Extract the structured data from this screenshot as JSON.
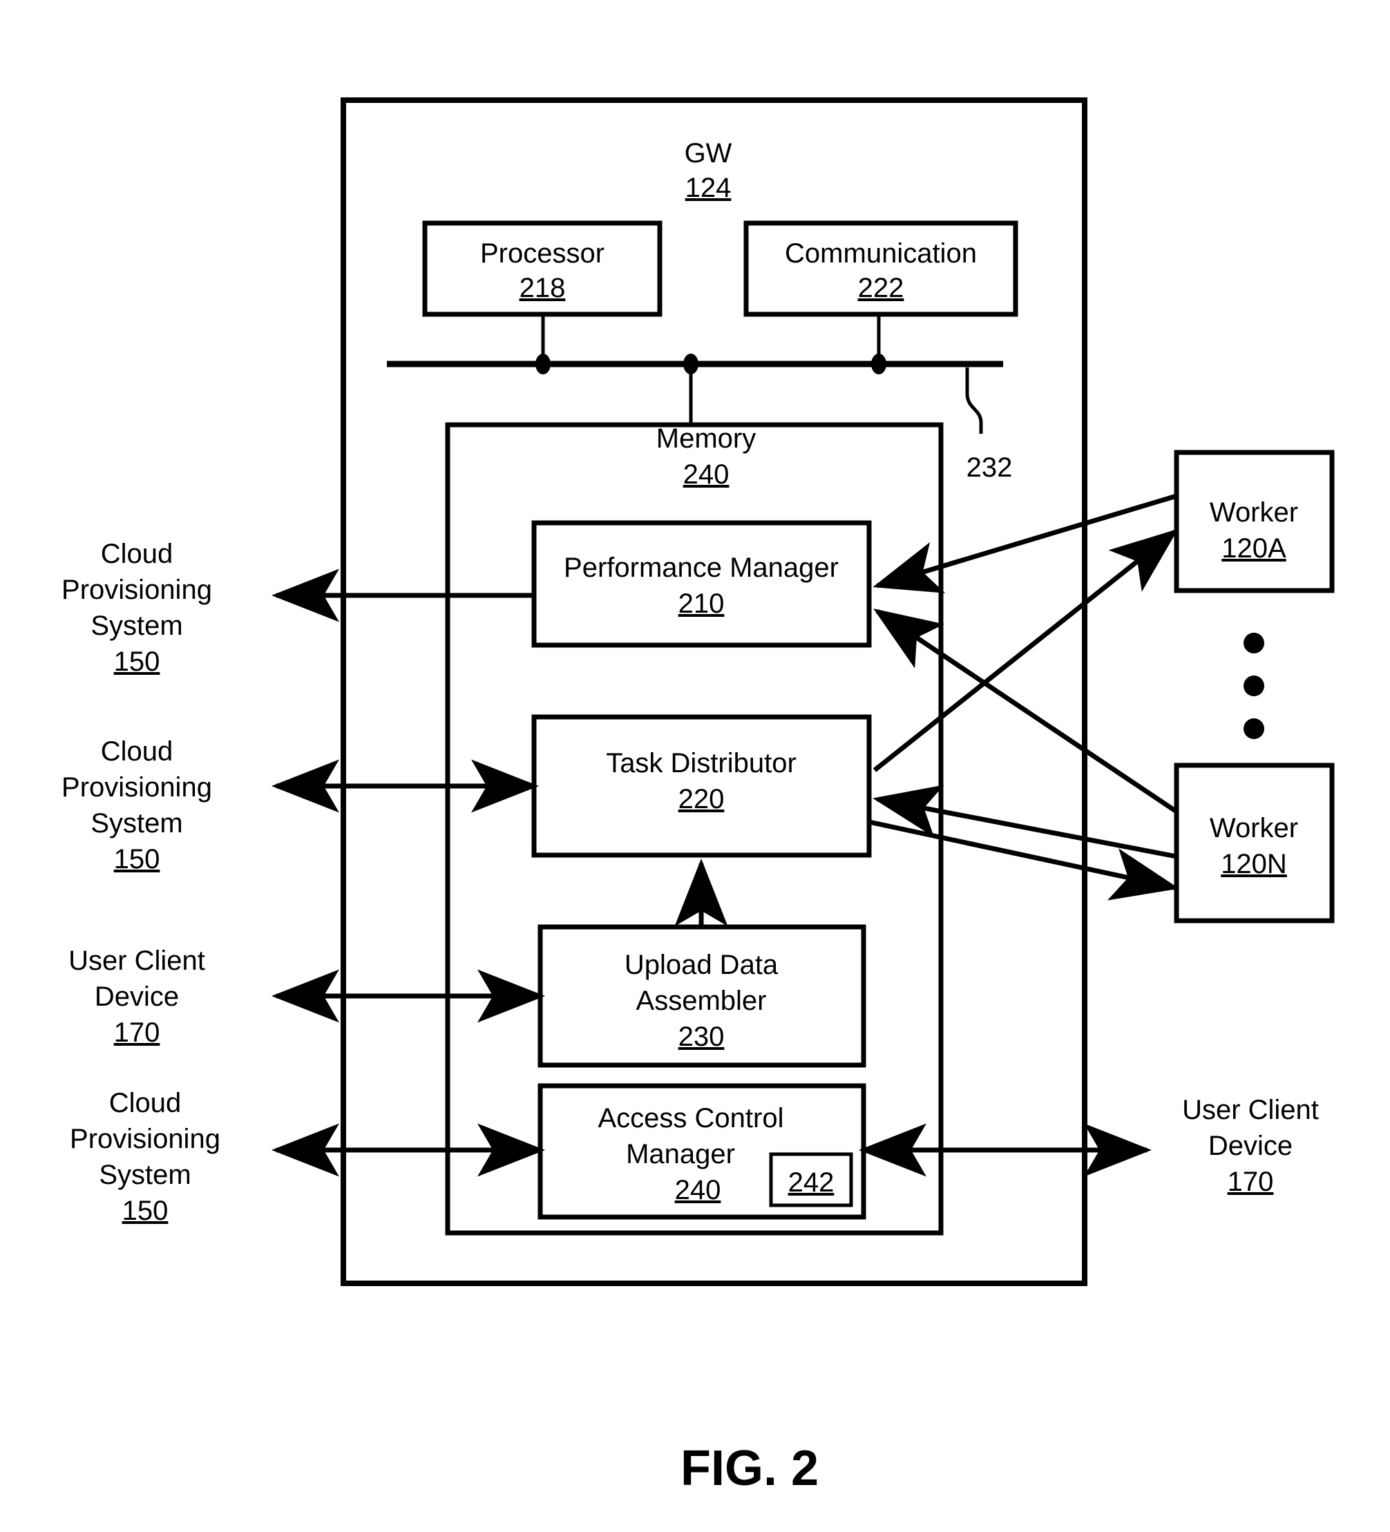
{
  "figure": {
    "caption": "FIG. 2"
  },
  "gw": {
    "title": "GW",
    "ref": "124"
  },
  "processor": {
    "title": "Processor",
    "ref": "218"
  },
  "communication": {
    "title": "Communication",
    "ref": "222"
  },
  "bus": {
    "ref": "232"
  },
  "memory": {
    "title": "Memory",
    "ref": "240"
  },
  "modules": [
    {
      "name": "performance-manager",
      "title": "Performance Manager",
      "ref": "210"
    },
    {
      "name": "task-distributor",
      "title": "Task Distributor",
      "ref": "220"
    },
    {
      "name": "upload-data-assembler",
      "title_line1": "Upload Data",
      "title_line2": "Assembler",
      "ref": "230"
    },
    {
      "name": "access-control-manager",
      "title_line1": "Access Control",
      "title_line2": "Manager",
      "ref": "240",
      "inner_ref": "242"
    }
  ],
  "external_left": [
    {
      "name": "cloud-provisioning-system-1",
      "line1": "Cloud",
      "line2": "Provisioning",
      "line3": "System",
      "ref": "150"
    },
    {
      "name": "cloud-provisioning-system-2",
      "line1": "Cloud",
      "line2": "Provisioning",
      "line3": "System",
      "ref": "150"
    },
    {
      "name": "user-client-device-left",
      "line1": "User Client",
      "line2": "Device",
      "ref": "170"
    },
    {
      "name": "cloud-provisioning-system-3",
      "line1": "Cloud",
      "line2": "Provisioning",
      "line3": "System",
      "ref": "150"
    }
  ],
  "external_right": [
    {
      "name": "worker-a",
      "title": "Worker",
      "ref": "120A"
    },
    {
      "name": "worker-n",
      "title": "Worker",
      "ref": "120N"
    },
    {
      "name": "user-client-device-right",
      "line1": "User Client",
      "line2": "Device",
      "ref": "170"
    }
  ],
  "colors": {
    "stroke": "#000000",
    "background": "#ffffff"
  }
}
